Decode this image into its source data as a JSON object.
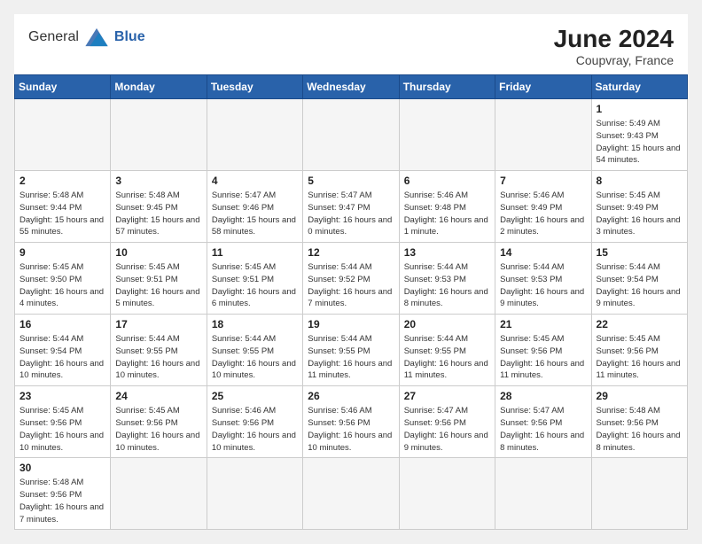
{
  "header": {
    "logo_general": "General",
    "logo_blue": "Blue",
    "month_year": "June 2024",
    "location": "Coupvray, France"
  },
  "weekdays": [
    "Sunday",
    "Monday",
    "Tuesday",
    "Wednesday",
    "Thursday",
    "Friday",
    "Saturday"
  ],
  "days": {
    "d1": {
      "num": "1",
      "sunrise": "Sunrise: 5:49 AM",
      "sunset": "Sunset: 9:43 PM",
      "daylight": "Daylight: 15 hours and 54 minutes."
    },
    "d2": {
      "num": "2",
      "sunrise": "Sunrise: 5:48 AM",
      "sunset": "Sunset: 9:44 PM",
      "daylight": "Daylight: 15 hours and 55 minutes."
    },
    "d3": {
      "num": "3",
      "sunrise": "Sunrise: 5:48 AM",
      "sunset": "Sunset: 9:45 PM",
      "daylight": "Daylight: 15 hours and 57 minutes."
    },
    "d4": {
      "num": "4",
      "sunrise": "Sunrise: 5:47 AM",
      "sunset": "Sunset: 9:46 PM",
      "daylight": "Daylight: 15 hours and 58 minutes."
    },
    "d5": {
      "num": "5",
      "sunrise": "Sunrise: 5:47 AM",
      "sunset": "Sunset: 9:47 PM",
      "daylight": "Daylight: 16 hours and 0 minutes."
    },
    "d6": {
      "num": "6",
      "sunrise": "Sunrise: 5:46 AM",
      "sunset": "Sunset: 9:48 PM",
      "daylight": "Daylight: 16 hours and 1 minute."
    },
    "d7": {
      "num": "7",
      "sunrise": "Sunrise: 5:46 AM",
      "sunset": "Sunset: 9:49 PM",
      "daylight": "Daylight: 16 hours and 2 minutes."
    },
    "d8": {
      "num": "8",
      "sunrise": "Sunrise: 5:45 AM",
      "sunset": "Sunset: 9:49 PM",
      "daylight": "Daylight: 16 hours and 3 minutes."
    },
    "d9": {
      "num": "9",
      "sunrise": "Sunrise: 5:45 AM",
      "sunset": "Sunset: 9:50 PM",
      "daylight": "Daylight: 16 hours and 4 minutes."
    },
    "d10": {
      "num": "10",
      "sunrise": "Sunrise: 5:45 AM",
      "sunset": "Sunset: 9:51 PM",
      "daylight": "Daylight: 16 hours and 5 minutes."
    },
    "d11": {
      "num": "11",
      "sunrise": "Sunrise: 5:45 AM",
      "sunset": "Sunset: 9:51 PM",
      "daylight": "Daylight: 16 hours and 6 minutes."
    },
    "d12": {
      "num": "12",
      "sunrise": "Sunrise: 5:44 AM",
      "sunset": "Sunset: 9:52 PM",
      "daylight": "Daylight: 16 hours and 7 minutes."
    },
    "d13": {
      "num": "13",
      "sunrise": "Sunrise: 5:44 AM",
      "sunset": "Sunset: 9:53 PM",
      "daylight": "Daylight: 16 hours and 8 minutes."
    },
    "d14": {
      "num": "14",
      "sunrise": "Sunrise: 5:44 AM",
      "sunset": "Sunset: 9:53 PM",
      "daylight": "Daylight: 16 hours and 9 minutes."
    },
    "d15": {
      "num": "15",
      "sunrise": "Sunrise: 5:44 AM",
      "sunset": "Sunset: 9:54 PM",
      "daylight": "Daylight: 16 hours and 9 minutes."
    },
    "d16": {
      "num": "16",
      "sunrise": "Sunrise: 5:44 AM",
      "sunset": "Sunset: 9:54 PM",
      "daylight": "Daylight: 16 hours and 10 minutes."
    },
    "d17": {
      "num": "17",
      "sunrise": "Sunrise: 5:44 AM",
      "sunset": "Sunset: 9:55 PM",
      "daylight": "Daylight: 16 hours and 10 minutes."
    },
    "d18": {
      "num": "18",
      "sunrise": "Sunrise: 5:44 AM",
      "sunset": "Sunset: 9:55 PM",
      "daylight": "Daylight: 16 hours and 10 minutes."
    },
    "d19": {
      "num": "19",
      "sunrise": "Sunrise: 5:44 AM",
      "sunset": "Sunset: 9:55 PM",
      "daylight": "Daylight: 16 hours and 11 minutes."
    },
    "d20": {
      "num": "20",
      "sunrise": "Sunrise: 5:44 AM",
      "sunset": "Sunset: 9:55 PM",
      "daylight": "Daylight: 16 hours and 11 minutes."
    },
    "d21": {
      "num": "21",
      "sunrise": "Sunrise: 5:45 AM",
      "sunset": "Sunset: 9:56 PM",
      "daylight": "Daylight: 16 hours and 11 minutes."
    },
    "d22": {
      "num": "22",
      "sunrise": "Sunrise: 5:45 AM",
      "sunset": "Sunset: 9:56 PM",
      "daylight": "Daylight: 16 hours and 11 minutes."
    },
    "d23": {
      "num": "23",
      "sunrise": "Sunrise: 5:45 AM",
      "sunset": "Sunset: 9:56 PM",
      "daylight": "Daylight: 16 hours and 10 minutes."
    },
    "d24": {
      "num": "24",
      "sunrise": "Sunrise: 5:45 AM",
      "sunset": "Sunset: 9:56 PM",
      "daylight": "Daylight: 16 hours and 10 minutes."
    },
    "d25": {
      "num": "25",
      "sunrise": "Sunrise: 5:46 AM",
      "sunset": "Sunset: 9:56 PM",
      "daylight": "Daylight: 16 hours and 10 minutes."
    },
    "d26": {
      "num": "26",
      "sunrise": "Sunrise: 5:46 AM",
      "sunset": "Sunset: 9:56 PM",
      "daylight": "Daylight: 16 hours and 10 minutes."
    },
    "d27": {
      "num": "27",
      "sunrise": "Sunrise: 5:47 AM",
      "sunset": "Sunset: 9:56 PM",
      "daylight": "Daylight: 16 hours and 9 minutes."
    },
    "d28": {
      "num": "28",
      "sunrise": "Sunrise: 5:47 AM",
      "sunset": "Sunset: 9:56 PM",
      "daylight": "Daylight: 16 hours and 8 minutes."
    },
    "d29": {
      "num": "29",
      "sunrise": "Sunrise: 5:48 AM",
      "sunset": "Sunset: 9:56 PM",
      "daylight": "Daylight: 16 hours and 8 minutes."
    },
    "d30": {
      "num": "30",
      "sunrise": "Sunrise: 5:48 AM",
      "sunset": "Sunset: 9:56 PM",
      "daylight": "Daylight: 16 hours and 7 minutes."
    }
  }
}
